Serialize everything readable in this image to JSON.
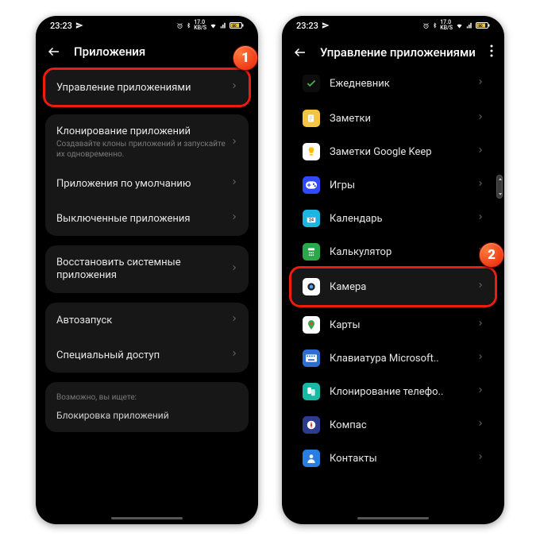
{
  "status": {
    "time": "23:23",
    "net_speed": "17.0",
    "net_unit": "KB/S",
    "battery": "80"
  },
  "screen1": {
    "title": "Приложения",
    "rows": {
      "manage": "Управление приложениями",
      "clone": "Клонирование приложений",
      "clone_sub": "Создавайте клоны приложений и запускайте их одновременно.",
      "default": "Приложения по умолчанию",
      "disabled": "Выключенные приложения",
      "restore": "Восстановить системные приложения",
      "autostart": "Автозапуск",
      "special": "Специальный доступ"
    },
    "suggest_hint": "Возможно, вы ищете:",
    "suggest_item": "Блокировка приложений",
    "badge": "1"
  },
  "screen2": {
    "title": "Управление приложениями",
    "apps": [
      {
        "label": "Ежедневник",
        "icon": "check",
        "bg": "#0d0d0d"
      },
      {
        "label": "Заметки",
        "icon": "note",
        "bg": "#f5c542"
      },
      {
        "label": "Заметки Google Keep",
        "icon": "keep",
        "bg": "#fff"
      },
      {
        "label": "Игры",
        "icon": "game",
        "bg": "#3148ff"
      },
      {
        "label": "Календарь",
        "icon": "calendar",
        "bg": "#1ab5e0"
      },
      {
        "label": "Калькулятор",
        "icon": "calc",
        "bg": "#2ba84a"
      },
      {
        "label": "Камера",
        "icon": "camera",
        "bg": "#fff"
      },
      {
        "label": "Карты",
        "icon": "maps",
        "bg": "#fff"
      },
      {
        "label": "Клавиатура Microsoft..",
        "icon": "kb",
        "bg": "#2c6dd1"
      },
      {
        "label": "Клонирование телефо..",
        "icon": "clone",
        "bg": "#17b8a6"
      },
      {
        "label": "Компас",
        "icon": "compass",
        "bg": "#2d3b8f"
      },
      {
        "label": "Контакты",
        "icon": "contacts",
        "bg": "#2a7de1"
      }
    ],
    "badge": "2"
  }
}
